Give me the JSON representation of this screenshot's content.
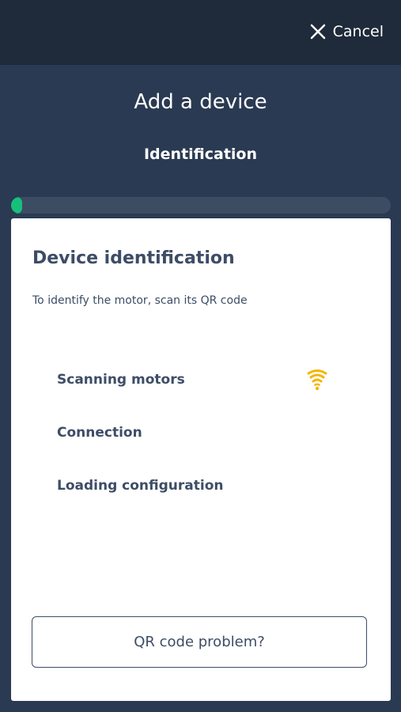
{
  "header": {
    "cancel_label": "Cancel",
    "cancel_icon": "close-icon"
  },
  "page": {
    "title": "Add a device",
    "subtitle": "Identification"
  },
  "progress": {
    "value_percent": 1.5,
    "color": "#16c07a"
  },
  "card": {
    "heading": "Device identification",
    "description": "To identify the motor, scan its QR code",
    "steps": [
      {
        "label": "Scanning motors",
        "status_icon": "wifi-scanning-icon",
        "active": true
      },
      {
        "label": "Connection"
      },
      {
        "label": "Loading configuration"
      }
    ],
    "qr_button_label": "QR code problem?"
  },
  "colors": {
    "background": "#2a3a52",
    "top_bar": "#1f2a3a",
    "text_dark": "#3d4d66",
    "scan_icon": "#f5b400"
  }
}
